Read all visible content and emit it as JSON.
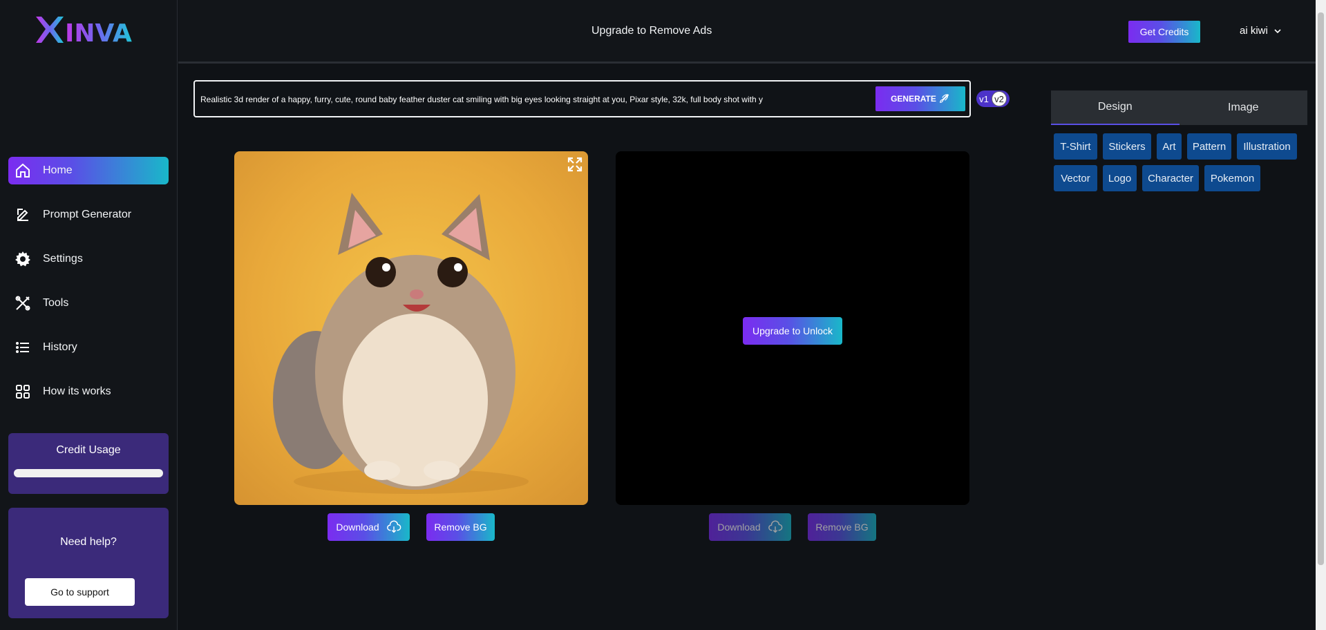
{
  "brand": {
    "name": "INVA"
  },
  "sidebar": {
    "items": [
      {
        "label": "Home",
        "icon": "home-icon",
        "active": true
      },
      {
        "label": "Prompt Generator",
        "icon": "edit-icon"
      },
      {
        "label": "Settings",
        "icon": "gear-icon"
      },
      {
        "label": "Tools",
        "icon": "tools-icon"
      },
      {
        "label": "History",
        "icon": "list-icon"
      },
      {
        "label": "How its works",
        "icon": "grid-icon"
      }
    ],
    "credit": {
      "title": "Credit Usage",
      "level": 1.0
    },
    "help": {
      "title": "Need help?",
      "button": "Go to support"
    }
  },
  "header": {
    "ad_text": "Upgrade to Remove Ads",
    "get_credits": "Get Credits",
    "user": "ai kiwi"
  },
  "prompt": {
    "value": "Realistic 3d render of a happy, furry, cute, round baby feather duster cat smiling with big eyes looking straight at you, Pixar style, 32k, full body shot with y",
    "generate": "GENERATE",
    "v1": "v1",
    "v2": "v2"
  },
  "results": {
    "card1": {
      "download": "Download",
      "remove_bg": "Remove BG"
    },
    "card2": {
      "upgrade": "Upgrade to Unlock",
      "download": "Download",
      "remove_bg": "Remove BG"
    }
  },
  "panel": {
    "tabs": [
      "Design",
      "Image"
    ],
    "chips": [
      "T-Shirt",
      "Stickers",
      "Art",
      "Pattern",
      "Illustration",
      "Vector",
      "Logo",
      "Character",
      "Pokemon"
    ]
  },
  "colors": {
    "accent_start": "#7b2cf0",
    "accent_end": "#19b8c9",
    "chip": "#0e4a8f",
    "panel_purple": "#3b2a7a"
  }
}
